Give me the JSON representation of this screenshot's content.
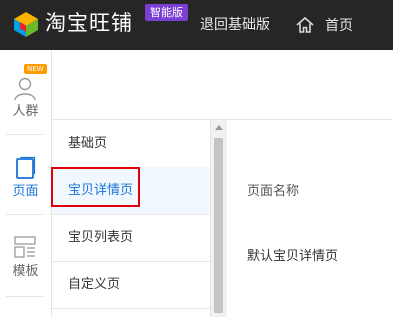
{
  "header": {
    "brand": "淘宝旺铺",
    "badge": "智能版",
    "back_link": "退回基础版",
    "home_label": "首页"
  },
  "leftnav": {
    "items": [
      {
        "label": "人群",
        "icon": "person-icon",
        "tag": "NEW"
      },
      {
        "label": "页面",
        "icon": "page-icon"
      },
      {
        "label": "模板",
        "icon": "template-icon"
      }
    ]
  },
  "pages": {
    "items": [
      {
        "label": "基础页"
      },
      {
        "label": "宝贝详情页",
        "active": true
      },
      {
        "label": "宝贝列表页"
      },
      {
        "label": "自定义页"
      }
    ]
  },
  "detail": {
    "name_label": "页面名称",
    "name_value": "默认宝贝详情页"
  },
  "colors": {
    "topbar": "#262626",
    "badge": "#7c3fd6",
    "accent": "#1a74d6",
    "highlight_box": "#e0000b",
    "new_tag": "#ff9a00"
  }
}
